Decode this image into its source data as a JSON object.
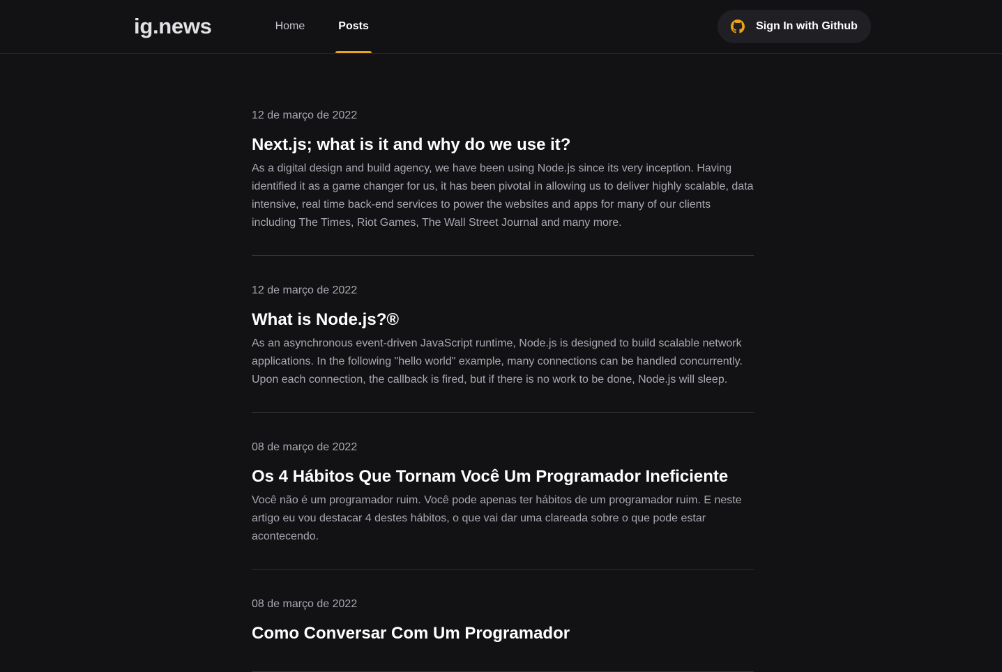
{
  "header": {
    "logo": "ig.news",
    "nav": [
      {
        "label": "Home",
        "active": false
      },
      {
        "label": "Posts",
        "active": true
      }
    ],
    "signin_label": "Sign In with Github",
    "accent_color": "#eba417",
    "signin_icon": "github-icon"
  },
  "posts": [
    {
      "date": "12 de março de 2022",
      "title": "Next.js; what is it and why do we use it?",
      "excerpt": "As a digital design and build agency, we have been using Node.js since its very inception. Having identified it as a game changer for us, it has been pivotal in allowing us to deliver highly scalable, data intensive, real time back-end services to power the websites and apps for many of our clients including The Times, Riot Games, The Wall Street Journal and many more."
    },
    {
      "date": "12 de março de 2022",
      "title": "What is Node.js?®",
      "excerpt": "As an asynchronous event-driven JavaScript runtime, Node.js is designed to build scalable network applications. In the following \"hello world\" example, many connections can be handled concurrently. Upon each connection, the callback is fired, but if there is no work to be done, Node.js will sleep."
    },
    {
      "date": "08 de março de 2022",
      "title": "Os 4 Hábitos Que Tornam Você Um Programador Ineficiente",
      "excerpt": "Você não é um programador ruim. Você pode apenas ter hábitos de um programador ruim. E neste artigo eu vou destacar 4 destes hábitos, o que vai dar uma clareada sobre o que pode estar acontecendo."
    },
    {
      "date": "08 de março de 2022",
      "title": "Como Conversar Com Um Programador",
      "excerpt": ""
    }
  ]
}
